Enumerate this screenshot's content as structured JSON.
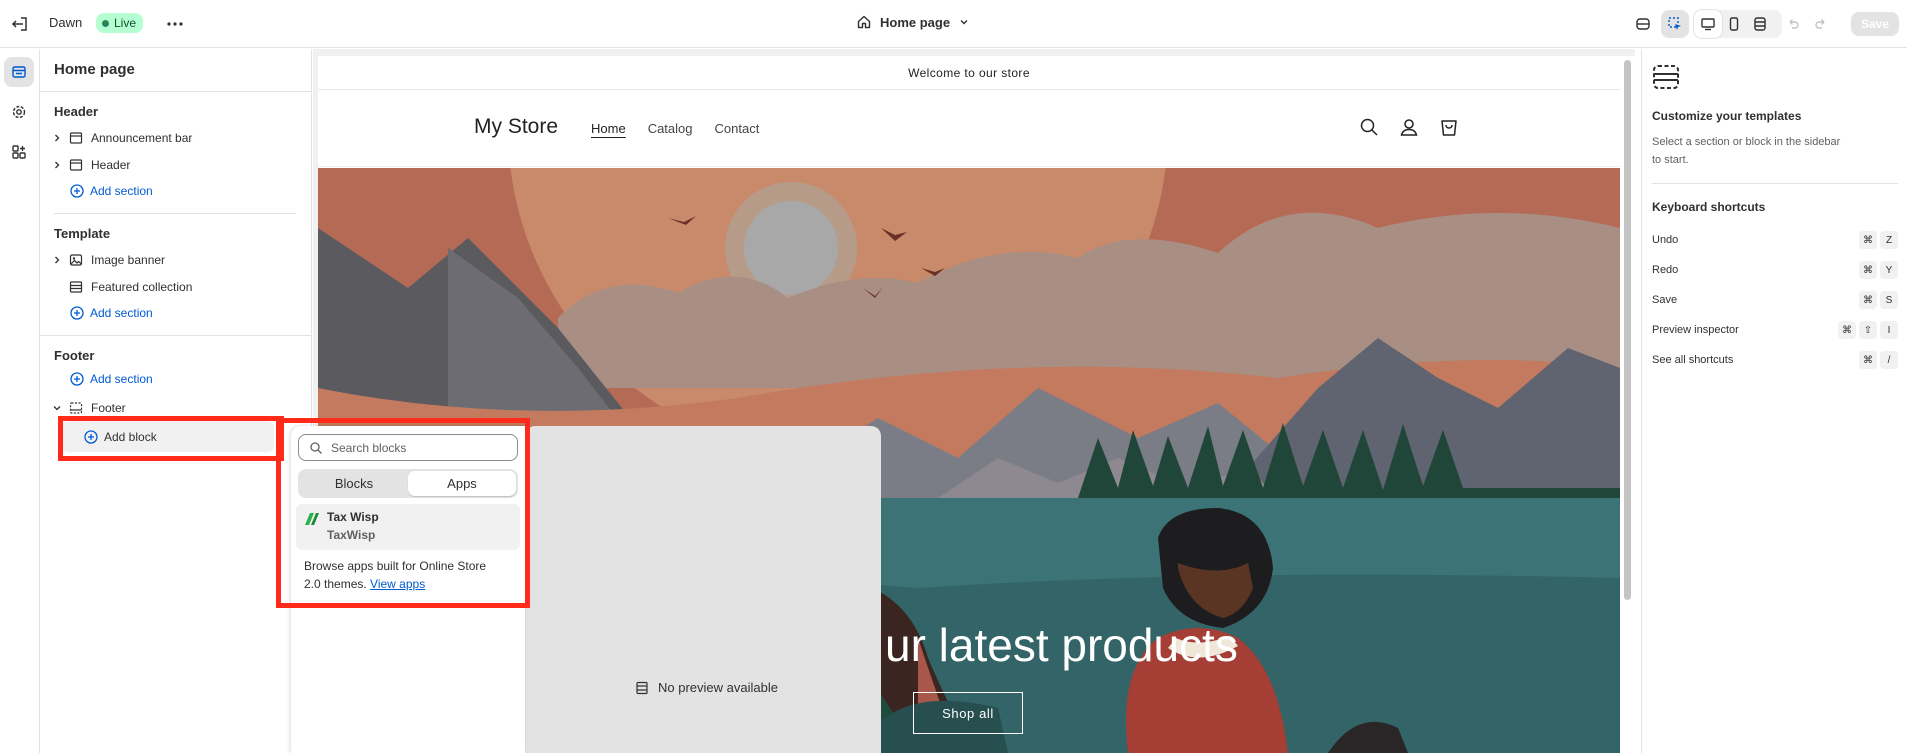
{
  "topbar": {
    "theme_name": "Dawn",
    "live_badge": "Live",
    "page_selector": "Home page",
    "save_label": "Save"
  },
  "sidebar": {
    "title": "Home page",
    "header_group": {
      "heading": "Header",
      "items": [
        "Announcement bar",
        "Header"
      ],
      "add_section": "Add section"
    },
    "template_group": {
      "heading": "Template",
      "items": [
        "Image banner",
        "Featured collection"
      ],
      "add_section": "Add section"
    },
    "footer_group": {
      "heading": "Footer",
      "add_section": "Add section",
      "footer_item": "Footer",
      "add_block": "Add block"
    }
  },
  "block_picker": {
    "search_placeholder": "Search blocks",
    "tabs": [
      "Blocks",
      "Apps"
    ],
    "selected_tab": "Apps",
    "app": {
      "name": "Tax Wisp",
      "developer": "TaxWisp"
    },
    "browse_text": "Browse apps built for Online Store 2.0 themes.",
    "browse_link": "View apps"
  },
  "no_preview": "No preview available",
  "store_preview": {
    "announcement": "Welcome to our store",
    "logo": "My Store",
    "nav": [
      "Home",
      "Catalog",
      "Contact"
    ],
    "banner_heading": "ur latest products",
    "banner_button": "Shop all"
  },
  "inspector": {
    "title": "Customize your templates",
    "description": "Select a section or block in the sidebar to start.",
    "shortcuts_title": "Keyboard shortcuts",
    "shortcuts": [
      {
        "label": "Undo",
        "keys": [
          "⌘",
          "Z"
        ]
      },
      {
        "label": "Redo",
        "keys": [
          "⌘",
          "Y"
        ]
      },
      {
        "label": "Save",
        "keys": [
          "⌘",
          "S"
        ]
      },
      {
        "label": "Preview inspector",
        "keys": [
          "⌘",
          "⇧",
          "I"
        ]
      },
      {
        "label": "See all shortcuts",
        "keys": [
          "⌘",
          "/"
        ]
      }
    ]
  },
  "colors": {
    "accent": "#005bd3",
    "highlight": "#ff2a1a",
    "live_badge_bg": "#b4fed2"
  }
}
